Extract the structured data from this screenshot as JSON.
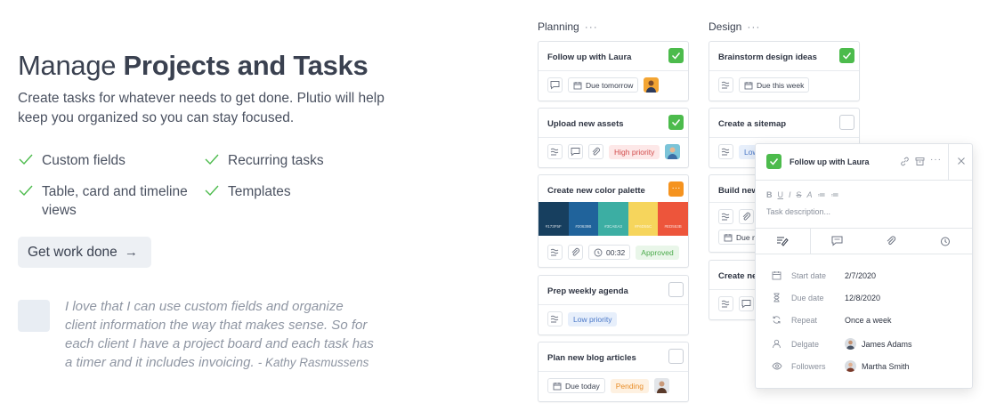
{
  "hero": {
    "title_light": "Manage ",
    "title_bold": "Projects and Tasks",
    "subtitle": "Create tasks for whatever needs to get done. Plutio will help keep you organized so you can stay focused."
  },
  "features": [
    {
      "label": "Custom fields"
    },
    {
      "label": "Recurring tasks"
    },
    {
      "label": "Table, card and timeline views"
    },
    {
      "label": "Templates"
    }
  ],
  "cta": {
    "label": "Get work done",
    "arrow": "→"
  },
  "quote": {
    "text": "I love that I can use custom fields and organize client information the way that makes sense. So for each client I have a project board and each task has a timer and it includes invoicing.",
    "author": "- Kathy Rasmussens"
  },
  "board": {
    "columns": [
      {
        "name": "Planning",
        "menu": "···"
      },
      {
        "name": "Design",
        "menu": "···"
      }
    ],
    "planning": {
      "card1": {
        "title": "Follow up with Laura",
        "due": "Due tomorrow"
      },
      "card2": {
        "title": "Upload new assets",
        "tag": "High priority"
      },
      "card3": {
        "title": "Create new color palette",
        "menu": "···",
        "timer": "00:32",
        "tag": "Approved",
        "swatches": [
          {
            "color": "#173f5f",
            "code": "#173F5F"
          },
          {
            "color": "#20639b",
            "code": "#20639B"
          },
          {
            "color": "#3caea3",
            "code": "#3CAEA3"
          },
          {
            "color": "#f6d55c",
            "code": "#F6D55C"
          },
          {
            "color": "#ed553b",
            "code": "#ED553B"
          }
        ]
      },
      "card4": {
        "title": "Prep weekly agenda",
        "tag": "Low priority"
      },
      "card5": {
        "title": "Plan new blog articles",
        "due": "Due today",
        "tag": "Pending"
      }
    },
    "design": {
      "card1": {
        "title": "Brainstorm design ideas",
        "due": "Due this week"
      },
      "card2": {
        "title": "Create a sitemap",
        "tag": "Low"
      },
      "card3": {
        "title": "Build new",
        "due": "Due n"
      },
      "card4": {
        "title": "Create new"
      }
    }
  },
  "detail": {
    "title": "Follow up with Laura",
    "format_tools": [
      "B",
      "U",
      "I",
      "S",
      "A",
      "≔",
      "≔"
    ],
    "desc_placeholder": "Task description...",
    "props": [
      {
        "label": "Start date",
        "value": "2/7/2020"
      },
      {
        "label": "Due date",
        "value": "12/8/2020"
      },
      {
        "label": "Repeat",
        "value": "Once a week"
      },
      {
        "label": "Delgate",
        "value": "James Adams"
      },
      {
        "label": "Followers",
        "value": "Martha Smith"
      }
    ]
  },
  "colors": {
    "accent_green": "#4cbb4c",
    "accent_orange": "#f5931f",
    "text": "#3a4150",
    "muted": "#8f96a3"
  }
}
